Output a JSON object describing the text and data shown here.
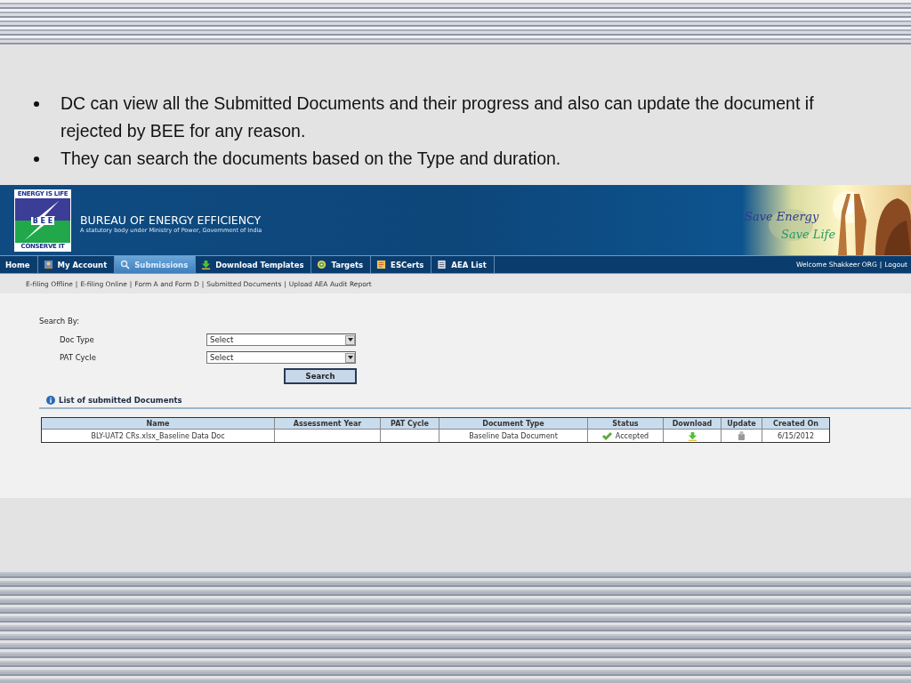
{
  "bullets": [
    "DC can view all the Submitted Documents and their progress and also can update the document if rejected by BEE for any reason.",
    "They can search the documents based on the Type and duration."
  ],
  "header": {
    "logo": {
      "top": "ENERGY IS LIFE",
      "middle": "B E E",
      "bottom": "CONSERVE IT"
    },
    "title": "BUREAU OF ENERGY EFFICIENCY",
    "subtitle": "A statutory body under Ministry of Power, Government of India",
    "banner": {
      "kind": "picture",
      "tagline_1": "Save Energy",
      "tagline_2": "Save Life"
    }
  },
  "nav": {
    "tabs": [
      {
        "label": "Home",
        "selected": false
      },
      {
        "label": "My Account",
        "selected": false
      },
      {
        "label": "Submissions",
        "selected": true
      },
      {
        "label": "Download Templates",
        "selected": false
      },
      {
        "label": "Targets",
        "selected": false
      },
      {
        "label": "ESCerts",
        "selected": false
      },
      {
        "label": "AEA List",
        "selected": false
      }
    ],
    "welcome": "Welcome Shakkeer ORG",
    "separator": "|",
    "logout": "Logout"
  },
  "subnav": [
    {
      "kind": "link",
      "text": "E-filing Offline"
    },
    {
      "kind": "separator",
      "text": "|"
    },
    {
      "kind": "link",
      "text": "E-filing Online"
    },
    {
      "kind": "separator",
      "text": "|"
    },
    {
      "kind": "link",
      "text": "Form A and Form D"
    },
    {
      "kind": "separator",
      "text": "|"
    },
    {
      "kind": "link",
      "text": "Submitted Documents"
    },
    {
      "kind": "separator",
      "text": "|"
    },
    {
      "kind": "link",
      "text": "Upload AEA Audit Report"
    }
  ],
  "search": {
    "title": "Search By:",
    "fields": [
      {
        "label": "Doc Type",
        "value": "Select"
      },
      {
        "label": "PAT Cycle",
        "value": "Select"
      }
    ],
    "button": "Search"
  },
  "table": {
    "title": "List of submitted Documents",
    "columns": [
      "Name",
      "Assessment Year",
      "PAT Cycle",
      "Document Type",
      "Status",
      "Download",
      "Update",
      "Created On"
    ],
    "rows": [
      {
        "name": "BLY-UAT2 CRs.xlsx_Baseline Data Doc",
        "assessment_year": "",
        "pat_cycle": "",
        "document_type": "Baseline Data Document",
        "status": "Accepted",
        "created_on": "6/15/2012"
      }
    ]
  }
}
